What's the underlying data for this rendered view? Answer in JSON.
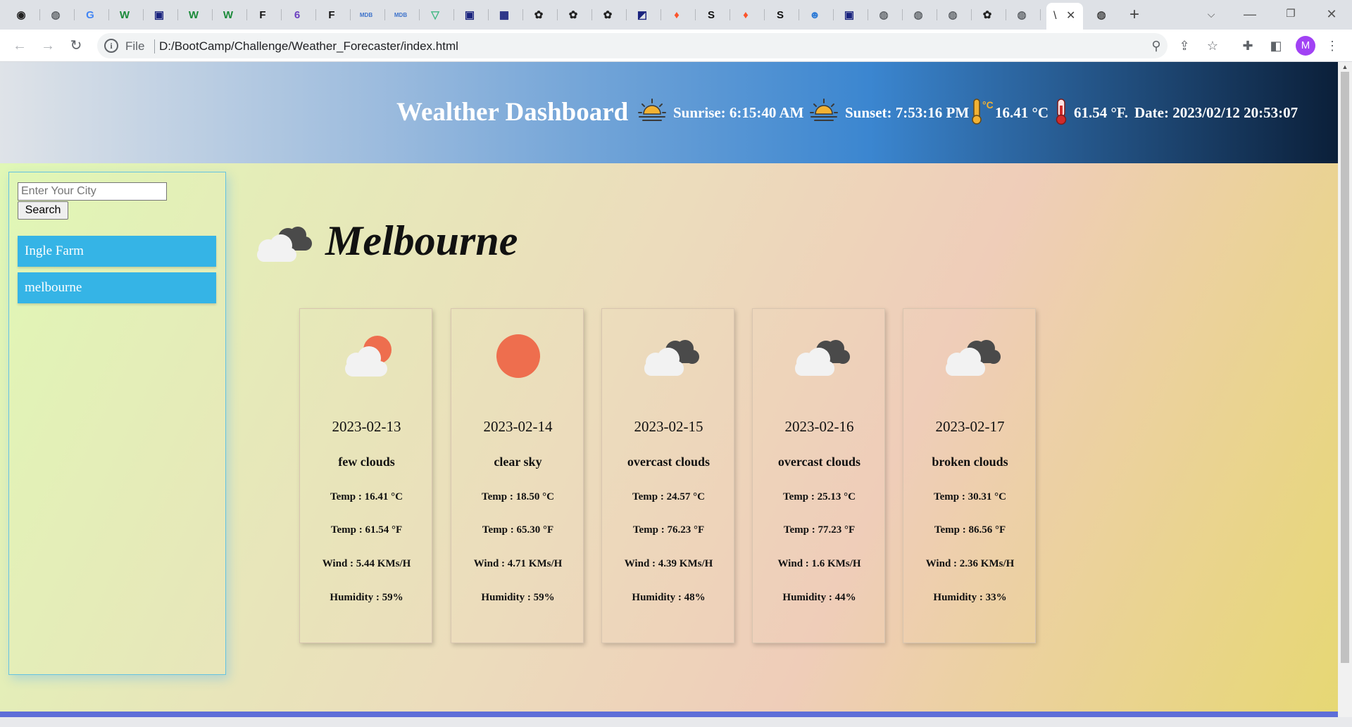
{
  "browser": {
    "tabs": [
      {
        "icon": "github-icon",
        "glyph": "◉"
      },
      {
        "icon": "globe-icon",
        "glyph": "◍"
      },
      {
        "icon": "google-icon",
        "glyph": "G"
      },
      {
        "icon": "w-icon",
        "glyph": "W"
      },
      {
        "icon": "app-icon",
        "glyph": "▣"
      },
      {
        "icon": "w-icon",
        "glyph": "W"
      },
      {
        "icon": "w-icon",
        "glyph": "W"
      },
      {
        "icon": "f-icon",
        "glyph": "F"
      },
      {
        "icon": "six-icon",
        "glyph": "6"
      },
      {
        "icon": "f-icon",
        "glyph": "F"
      },
      {
        "icon": "mdb-icon",
        "glyph": "MDB"
      },
      {
        "icon": "mdb-icon",
        "glyph": "MDB"
      },
      {
        "icon": "vue-icon",
        "glyph": "▽"
      },
      {
        "icon": "app-icon",
        "glyph": "▣"
      },
      {
        "icon": "app-icon",
        "glyph": "▦"
      },
      {
        "icon": "openai-icon",
        "glyph": "✿"
      },
      {
        "icon": "openai-icon",
        "glyph": "✿"
      },
      {
        "icon": "openai-icon",
        "glyph": "✿"
      },
      {
        "icon": "app-icon",
        "glyph": "◩"
      },
      {
        "icon": "brave-icon",
        "glyph": "♦"
      },
      {
        "icon": "s-icon",
        "glyph": "S"
      },
      {
        "icon": "brave-icon",
        "glyph": "♦"
      },
      {
        "icon": "s-icon",
        "glyph": "S"
      },
      {
        "icon": "bot-icon",
        "glyph": "☻"
      },
      {
        "icon": "app-icon",
        "glyph": "▣"
      },
      {
        "icon": "globe-icon",
        "glyph": "◍"
      },
      {
        "icon": "globe-icon",
        "glyph": "◍"
      },
      {
        "icon": "globe-icon",
        "glyph": "◍"
      },
      {
        "icon": "openai-icon",
        "glyph": "✿"
      },
      {
        "icon": "globe-icon",
        "glyph": "◍"
      }
    ],
    "active_tab_label": "\\",
    "url_scheme": "File",
    "url": "D:/BootCamp/Challenge/Weather_Forecaster/index.html",
    "profile_initial": "M"
  },
  "header": {
    "title": "Wealther Dashboard",
    "sunrise": "Sunrise: 6:15:40 AM",
    "sunset": "Sunset: 7:53:16 PM",
    "temp_c": "16.41 °C",
    "temp_f": "61.54 °F.",
    "date": "Date: 2023/02/12 20:53:07"
  },
  "sidebar": {
    "search_placeholder": "Enter Your City",
    "search_value": "",
    "search_button": "Search",
    "history": [
      "Ingle Farm",
      "melbourne"
    ]
  },
  "current": {
    "city": "Melbourne",
    "icon": "broken-clouds-icon"
  },
  "forecast": [
    {
      "date": "2023-02-13",
      "desc": "few clouds",
      "temp_c": "Temp : 16.41 °C",
      "temp_f": "Temp : 61.54 °F",
      "wind": "Wind : 5.44 KMs/H",
      "humidity": "Humidity : 59%",
      "icon": "few-clouds-icon"
    },
    {
      "date": "2023-02-14",
      "desc": "clear sky",
      "temp_c": "Temp : 18.50 °C",
      "temp_f": "Temp : 65.30 °F",
      "wind": "Wind : 4.71 KMs/H",
      "humidity": "Humidity : 59%",
      "icon": "clear-sky-icon"
    },
    {
      "date": "2023-02-15",
      "desc": "overcast clouds",
      "temp_c": "Temp : 24.57 °C",
      "temp_f": "Temp : 76.23 °F",
      "wind": "Wind : 4.39 KMs/H",
      "humidity": "Humidity : 48%",
      "icon": "overcast-clouds-icon"
    },
    {
      "date": "2023-02-16",
      "desc": "overcast clouds",
      "temp_c": "Temp : 25.13 °C",
      "temp_f": "Temp : 77.23 °F",
      "wind": "Wind : 1.6 KMs/H",
      "humidity": "Humidity : 44%",
      "icon": "overcast-clouds-icon"
    },
    {
      "date": "2023-02-17",
      "desc": "broken clouds",
      "temp_c": "Temp : 30.31 °C",
      "temp_f": "Temp : 86.56 °F",
      "wind": "Wind : 2.36 KMs/H",
      "humidity": "Humidity : 33%",
      "icon": "broken-clouds-icon"
    }
  ],
  "colors": {
    "sun": "#ee6e4e",
    "dark_cloud": "#4a4a4a",
    "light_cloud": "#f2f2f2",
    "history_button": "#35b4e6"
  }
}
